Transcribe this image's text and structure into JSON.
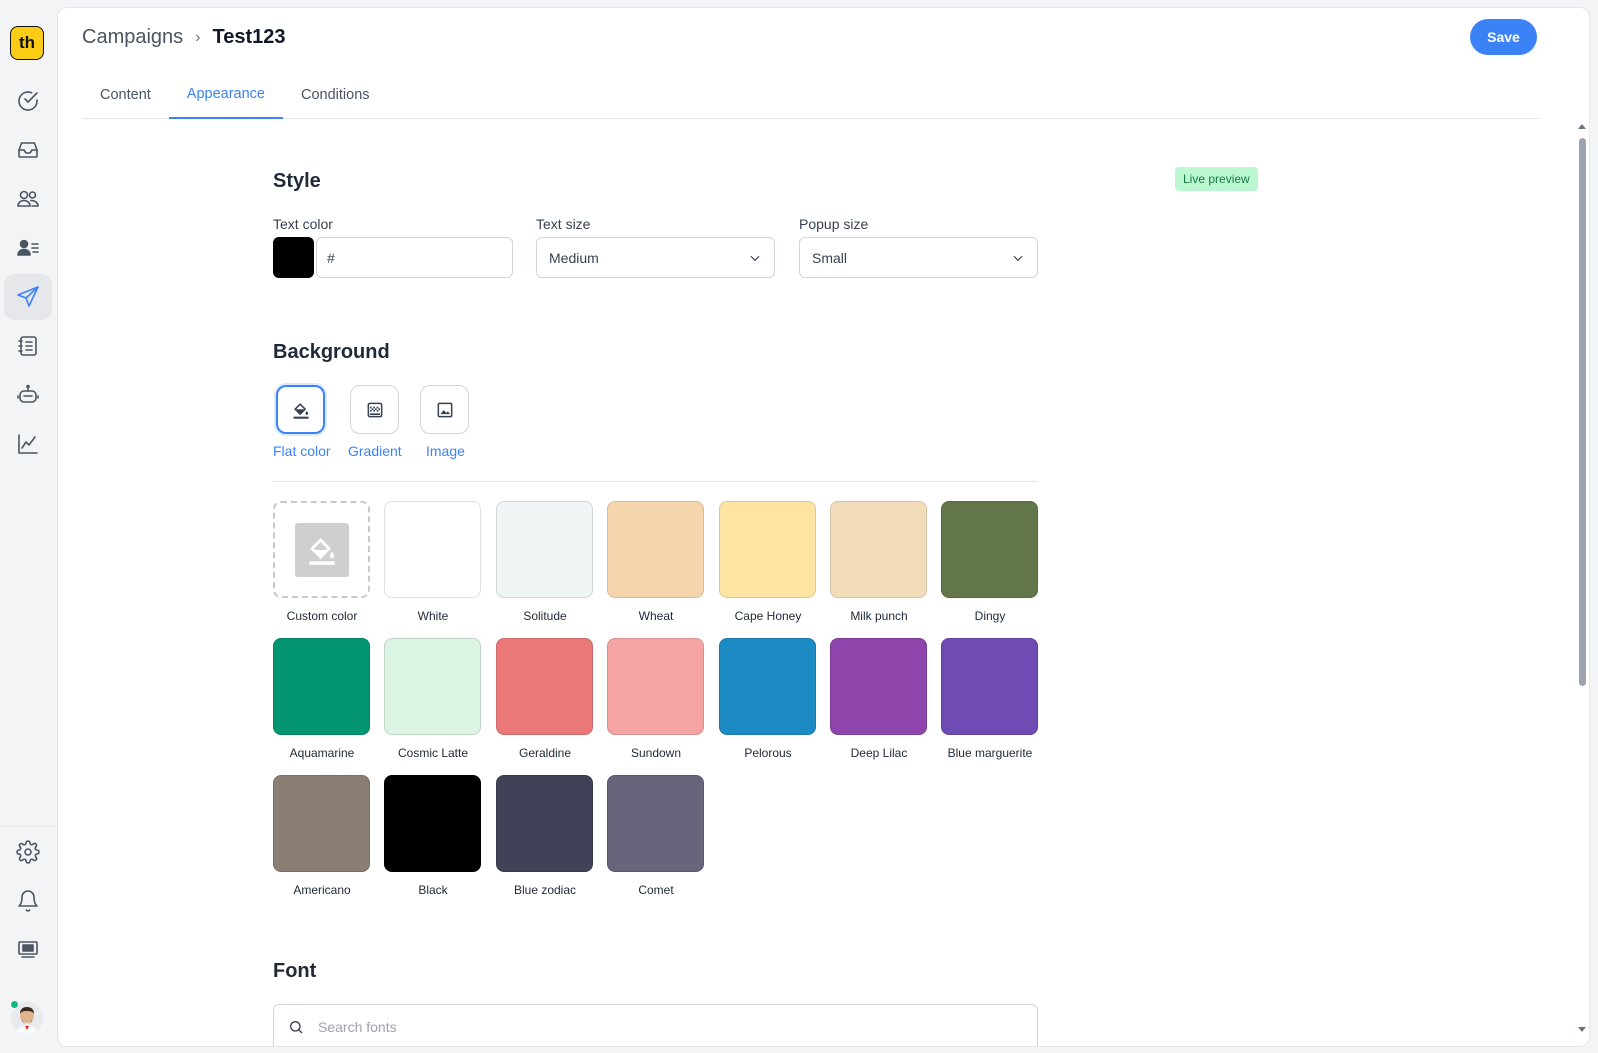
{
  "app": {
    "logo_text": "th"
  },
  "breadcrumb": {
    "parent": "Campaigns",
    "separator": "›",
    "current": "Test123"
  },
  "header": {
    "save_label": "Save"
  },
  "tabs": [
    {
      "label": "Content",
      "active": false
    },
    {
      "label": "Appearance",
      "active": true
    },
    {
      "label": "Conditions",
      "active": false
    }
  ],
  "style": {
    "title": "Style",
    "live_preview": "Live preview",
    "text_color_label": "Text color",
    "text_color_value": "#",
    "text_color_swatch": "#000000",
    "text_size_label": "Text size",
    "text_size_value": "Medium",
    "popup_size_label": "Popup size",
    "popup_size_value": "Small"
  },
  "background": {
    "title": "Background",
    "options": [
      {
        "label": "Flat color",
        "icon": "paint-bucket-icon",
        "active": true
      },
      {
        "label": "Gradient",
        "icon": "gradient-icon",
        "active": false
      },
      {
        "label": "Image",
        "icon": "image-icon",
        "active": false
      }
    ],
    "swatches": [
      {
        "name": "Custom color",
        "color": null
      },
      {
        "name": "White",
        "color": "#ffffff"
      },
      {
        "name": "Solitude",
        "color": "#eef5f4"
      },
      {
        "name": "Wheat",
        "color": "#f5d5ad"
      },
      {
        "name": "Cape Honey",
        "color": "#fee4a3"
      },
      {
        "name": "Milk punch",
        "color": "#f3dcba"
      },
      {
        "name": "Dingy",
        "color": "#637649"
      },
      {
        "name": "Aquamarine",
        "color": "#039471"
      },
      {
        "name": "Cosmic Latte",
        "color": "#dcf4e4"
      },
      {
        "name": "Geraldine",
        "color": "#ea7879"
      },
      {
        "name": "Sundown",
        "color": "#f6a3a3"
      },
      {
        "name": "Pelorous",
        "color": "#1d8bc3"
      },
      {
        "name": "Deep Lilac",
        "color": "#8e45ac"
      },
      {
        "name": "Blue marguerite",
        "color": "#6f4bb4"
      },
      {
        "name": "Americano",
        "color": "#8b7f75"
      },
      {
        "name": "Black",
        "color": "#000000"
      },
      {
        "name": "Blue zodiac",
        "color": "#404358"
      },
      {
        "name": "Comet",
        "color": "#67657b"
      }
    ]
  },
  "font": {
    "title": "Font",
    "search_placeholder": "Search fonts"
  },
  "sidebar": {
    "items": [
      {
        "icon": "check-circle-icon",
        "active": false
      },
      {
        "icon": "inbox-icon",
        "active": false
      },
      {
        "icon": "users-icon",
        "active": false
      },
      {
        "icon": "contacts-icon",
        "active": false
      },
      {
        "icon": "send-icon",
        "active": true
      },
      {
        "icon": "notebook-icon",
        "active": false
      },
      {
        "icon": "bot-icon",
        "active": false
      },
      {
        "icon": "chart-line-icon",
        "active": false
      }
    ],
    "bottom": [
      {
        "icon": "gear-icon"
      },
      {
        "icon": "bell-icon"
      },
      {
        "icon": "billing-icon"
      }
    ]
  }
}
